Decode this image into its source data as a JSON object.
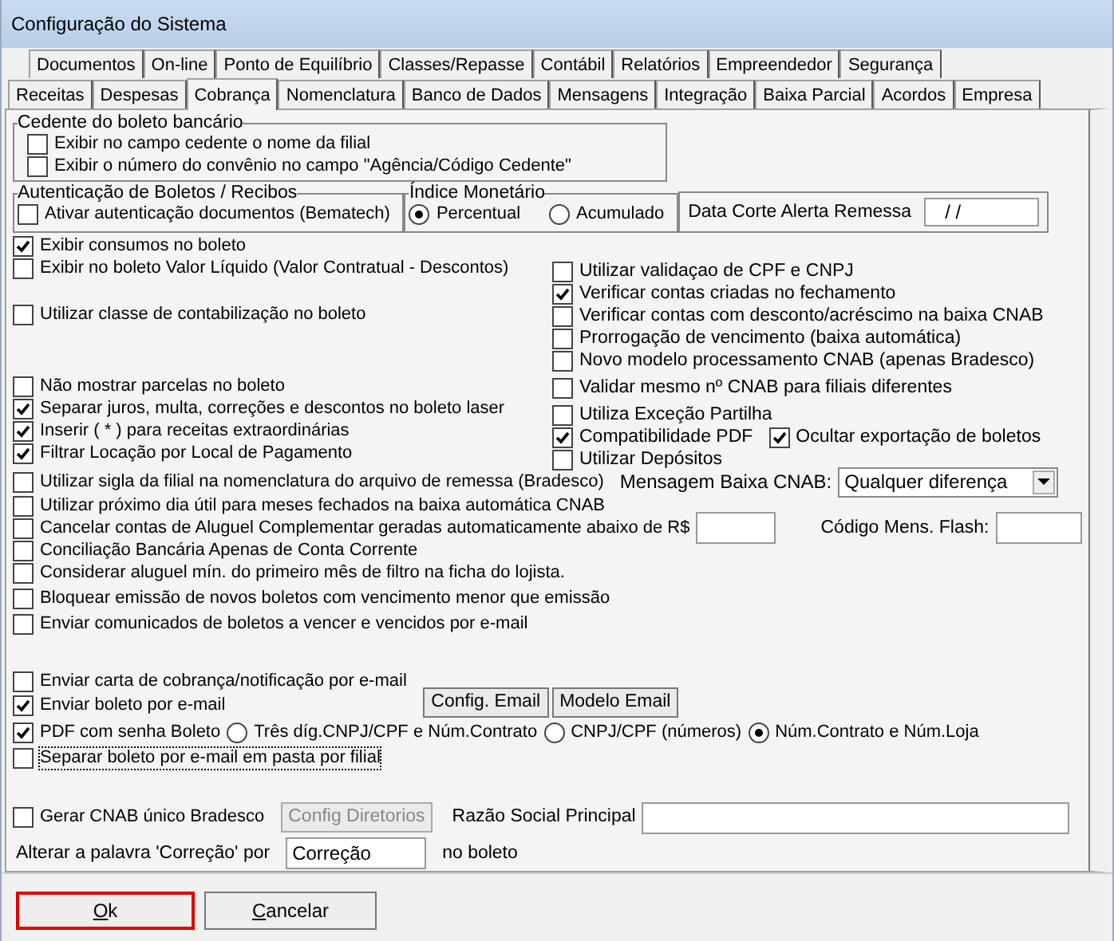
{
  "window": {
    "title": "Configuração do Sistema"
  },
  "tabs_row_1": [
    {
      "label": "Documentos",
      "selected": false
    },
    {
      "label": "On-line",
      "selected": false
    },
    {
      "label": "Ponto de Equilíbrio",
      "selected": false
    },
    {
      "label": "Classes/Repasse",
      "selected": false
    },
    {
      "label": "Contábil",
      "selected": false
    },
    {
      "label": "Relatórios",
      "selected": false
    },
    {
      "label": "Empreendedor",
      "selected": false
    },
    {
      "label": "Segurança",
      "selected": false
    }
  ],
  "tabs_row_2": [
    {
      "label": "Receitas",
      "selected": false
    },
    {
      "label": "Despesas",
      "selected": false
    },
    {
      "label": "Cobrança",
      "selected": true
    },
    {
      "label": "Nomenclatura",
      "selected": false
    },
    {
      "label": "Banco de Dados",
      "selected": false
    },
    {
      "label": "Mensagens",
      "selected": false
    },
    {
      "label": "Integração",
      "selected": false
    },
    {
      "label": "Baixa Parcial",
      "selected": false
    },
    {
      "label": "Acordos",
      "selected": false
    },
    {
      "label": "Empresa",
      "selected": false
    }
  ],
  "cedente_group": {
    "title": "Cedente do boleto bancário",
    "options": [
      {
        "label": "Exibir no campo cedente o nome da filial",
        "checked": false
      },
      {
        "label": "Exibir o número do convênio no campo \"Agência/Código Cedente\"",
        "checked": false
      }
    ]
  },
  "autenticacao_group": {
    "title": "Autenticação de Boletos / Recibos",
    "option": {
      "label": "Ativar autenticação documentos (Bematech)",
      "checked": false
    }
  },
  "indice_group": {
    "title": "Índice Monetário",
    "options": [
      {
        "label": "Percentual",
        "selected": true
      },
      {
        "label": "Acumulado",
        "selected": false
      }
    ]
  },
  "data_corte": {
    "label": "Data Corte Alerta Remessa",
    "value": "/ /"
  },
  "left_groups": [
    {
      "options": [
        {
          "label": "Exibir consumos no boleto",
          "checked": true
        },
        {
          "label": "Exibir no boleto Valor Líquido (Valor Contratual - Descontos)",
          "checked": false
        }
      ]
    },
    {
      "options": [
        {
          "label": "Utilizar classe de contabilização no boleto",
          "checked": false
        }
      ]
    },
    {
      "options": [
        {
          "label": "Não mostrar parcelas no boleto",
          "checked": false
        },
        {
          "label": "Separar juros, multa, correções e descontos no boleto laser",
          "checked": true
        },
        {
          "label": "Inserir ( * ) para receitas extraordinárias",
          "checked": true
        },
        {
          "label": "Filtrar Locação por Local de Pagamento",
          "checked": true
        }
      ]
    }
  ],
  "right_options": [
    {
      "label": "Utilizar validaçao de CPF e CNPJ",
      "checked": false
    },
    {
      "label": "Verificar contas criadas no fechamento",
      "checked": true
    },
    {
      "label": "Verificar contas com desconto/acréscimo na baixa CNAB",
      "checked": false
    },
    {
      "label": "Prorrogação de vencimento (baixa automática)",
      "checked": false
    },
    {
      "label": "Novo modelo processamento CNAB (apenas Bradesco)",
      "checked": false
    },
    {
      "label": "Validar mesmo nº CNAB para filiais diferentes",
      "checked": false
    },
    {
      "label": "Utiliza Exceção Partilha",
      "checked": false
    },
    {
      "label": "Compatibilidade PDF",
      "checked": true,
      "side_option": {
        "label": "Ocultar exportação de boletos",
        "checked": true
      }
    },
    {
      "label": "Utilizar Depósitos",
      "checked": false
    }
  ],
  "remessa_row": {
    "option": {
      "label": "Utilizar sigla da filial na nomenclatura do arquivo de remessa (Bradesco)",
      "checked": false
    },
    "mensagem_label": "Mensagem Baixa CNAB:",
    "mensagem_value": "Qualquer diferença"
  },
  "lower_options": [
    {
      "kind": "plain",
      "label": "Utilizar próximo dia útil para meses fechados na baixa automática CNAB",
      "checked": false
    },
    {
      "kind": "fields",
      "label": "Cancelar contas de Aluguel Complementar geradas automaticamente abaixo de R$",
      "checked": false,
      "flash_label": "Código Mens. Flash:"
    },
    {
      "kind": "plain",
      "label": "Conciliação Bancária Apenas de Conta Corrente",
      "checked": false
    },
    {
      "kind": "plain",
      "label": "Considerar aluguel mín. do primeiro mês de filtro na ficha do lojista.",
      "checked": false
    },
    {
      "kind": "plain",
      "label": "Bloquear emissão de novos boletos com vencimento menor que emissão",
      "checked": false
    },
    {
      "kind": "plain",
      "label": "Enviar comunicados de boletos a vencer e vencidos por e-mail",
      "checked": false
    }
  ],
  "email_options": [
    {
      "kind": "plain",
      "label": "Enviar carta de cobrança/notificação por e-mail",
      "checked": false,
      "focused": false
    },
    {
      "kind": "buttons",
      "label": "Enviar boleto por e-mail",
      "checked": true,
      "focused": false,
      "buttons": [
        "Config. Email",
        "Modelo Email"
      ]
    },
    {
      "kind": "radios",
      "label": "PDF com senha Boleto",
      "checked": true,
      "focused": false,
      "radios": [
        {
          "label": "Três díg.CNPJ/CPF e Núm.Contrato",
          "selected": false
        },
        {
          "label": "CNPJ/CPF (números)",
          "selected": false
        },
        {
          "label": "Núm.Contrato e Núm.Loja",
          "selected": true
        }
      ]
    },
    {
      "kind": "plain",
      "label": "Separar boleto por e-mail em pasta por filial",
      "checked": false,
      "focused": true
    }
  ],
  "cnab_row": {
    "option": {
      "label": "Gerar CNAB único Bradesco",
      "checked": false
    },
    "button": {
      "label": "Config Diretorios",
      "disabled": true
    },
    "razao_label": "Razão Social Principal"
  },
  "correcao_row": {
    "label": "Alterar a palavra 'Correção' por",
    "value": "Correção",
    "suffix": "no boleto"
  },
  "buttons": [
    {
      "label": "Ok",
      "focused": true
    },
    {
      "label": "Cancelar",
      "focused": false
    }
  ]
}
